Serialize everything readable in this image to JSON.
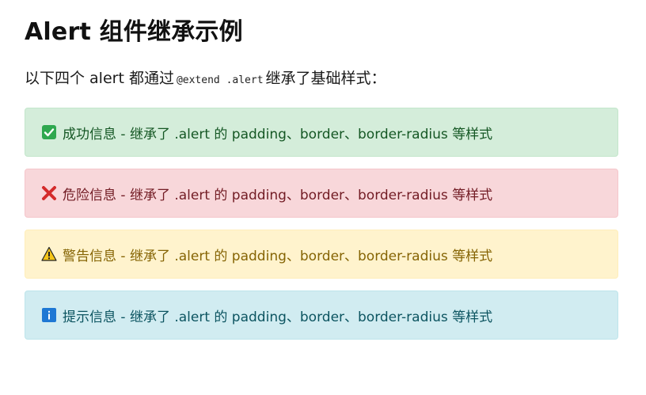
{
  "page": {
    "title": "Alert 组件继承示例",
    "intro_before": "以下四个 alert 都通过",
    "intro_code": "@extend .alert",
    "intro_after": "继承了基础样式："
  },
  "alerts": [
    {
      "type": "success",
      "icon": "check-box-icon",
      "text": "成功信息 - 继承了 .alert 的 padding、border、border-radius 等样式"
    },
    {
      "type": "danger",
      "icon": "cross-icon",
      "text": "危险信息 - 继承了 .alert 的 padding、border、border-radius 等样式"
    },
    {
      "type": "warning",
      "icon": "warning-triangle-icon",
      "text": "警告信息 - 继承了 .alert 的 padding、border、border-radius 等样式"
    },
    {
      "type": "info",
      "icon": "info-box-icon",
      "text": "提示信息 - 继承了 .alert 的 padding、border、border-radius 等样式"
    }
  ],
  "colors": {
    "success_bg": "#d4edda",
    "danger_bg": "#f8d7da",
    "warning_bg": "#fff3cd",
    "info_bg": "#d1ecf1"
  }
}
